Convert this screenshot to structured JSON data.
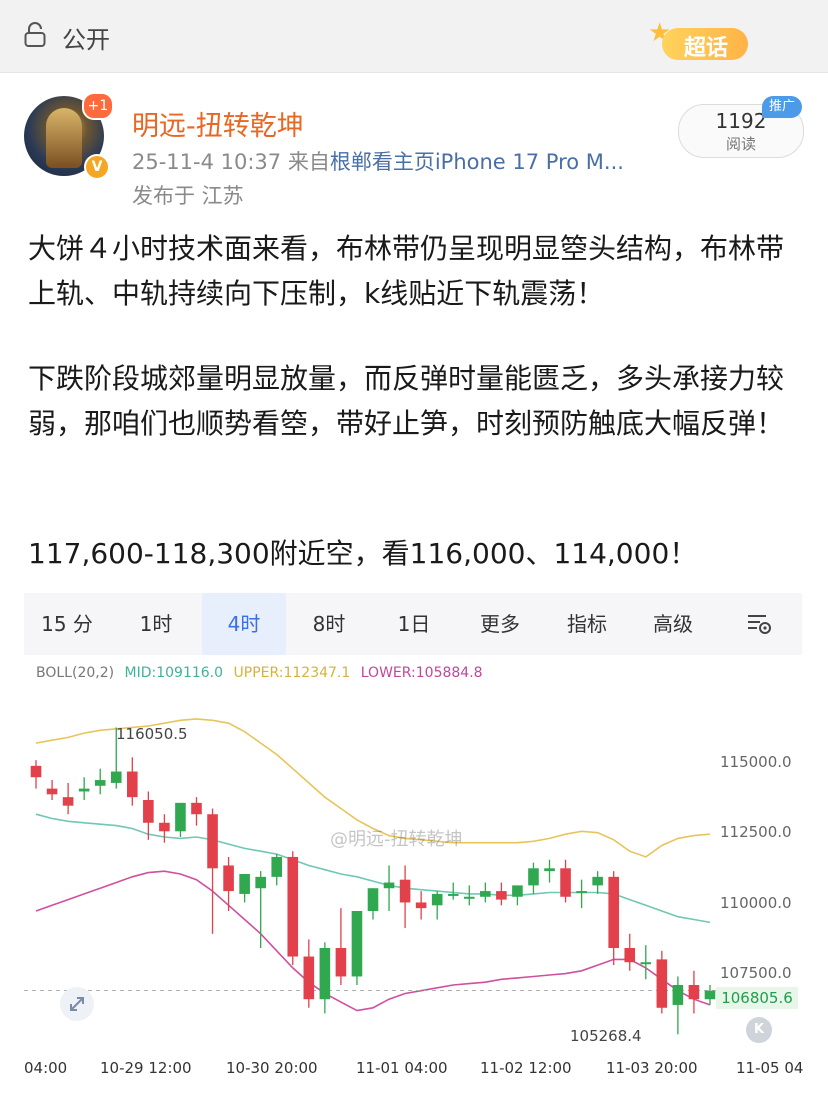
{
  "topbar": {
    "visibility": "公开",
    "supertopic": "超话"
  },
  "post": {
    "username": "明远-扭转乾坤",
    "avatar_badge": "+1",
    "time": "25-11-4 10:37",
    "source_prefix": "来自",
    "source": "根郸看主页iPhone 17 Pro M...",
    "location": "发布于 江苏",
    "read_count": "1192",
    "read_label": "阅读",
    "promo_tag": "推广",
    "paragraphs": [
      "大饼４小时技术面来看，布林带仍呈现明显箜头结构，布林带上轨、中轨持续向下压制，k线贴近下轨震荡！",
      "下跌阶段城郊量明显放量，而反弹时量能匮乏，多头承接力较弱，那咱们也顺势看箜，带好止笋，时刻预防触底大幅反弹！",
      "117,600-118,300附近空，看116,000、114,000！"
    ]
  },
  "chart_tabs": [
    "15 分",
    "1时",
    "4时",
    "8时",
    "1日",
    "更多",
    "指标",
    "高级"
  ],
  "active_tab": "4时",
  "boll": {
    "name": "BOLL(20,2)",
    "mid": "MID:109116.0",
    "upper": "UPPER:112347.1",
    "lower": "LOWER:105884.8"
  },
  "watermark": "@明远-扭转乾坤",
  "colors": {
    "up": "#2fa84f",
    "down": "#e2404a",
    "mid": "#6fc7b4",
    "upper": "#e7c55a",
    "lower": "#d04f9e",
    "accent": "#e86722"
  },
  "chart_data": {
    "type": "candlestick",
    "x_tick_labels": [
      "04:00",
      "10-29 12:00",
      "10-30 20:00",
      "11-01 04:00",
      "11-02 12:00",
      "11-03 20:00",
      "11-05 04"
    ],
    "y_tick_labels": [
      "115000.0",
      "112500.0",
      "110000.0",
      "107500.0"
    ],
    "current_price": "106805.6",
    "high_label": "116050.5",
    "low_label": "105268.4",
    "ylim": [
      104400,
      117400
    ],
    "candles": [
      [
        114700,
        114900,
        114300,
        113900
      ],
      [
        113900,
        114200,
        113700,
        113500
      ],
      [
        113600,
        114100,
        113300,
        113000
      ],
      [
        113800,
        114300,
        113900,
        113500
      ],
      [
        114000,
        114600,
        114200,
        113700
      ],
      [
        114100,
        116050,
        114500,
        113900
      ],
      [
        114500,
        115000,
        113600,
        113300
      ],
      [
        113500,
        113800,
        112700,
        112100
      ],
      [
        112700,
        113000,
        112400,
        112000
      ],
      [
        112400,
        113300,
        113400,
        112200
      ],
      [
        113400,
        113600,
        113000,
        112600
      ],
      [
        113000,
        113200,
        111100,
        108800
      ],
      [
        111200,
        111500,
        110300,
        109600
      ],
      [
        110200,
        110900,
        110900,
        109900
      ],
      [
        110400,
        111000,
        110800,
        108300
      ],
      [
        110800,
        111600,
        111500,
        110500
      ],
      [
        111500,
        111700,
        108000,
        107700
      ],
      [
        108000,
        108600,
        106500,
        106200
      ],
      [
        106500,
        108500,
        108300,
        106000
      ],
      [
        108300,
        109700,
        107300,
        107000
      ],
      [
        107300,
        109200,
        109600,
        107000
      ],
      [
        109600,
        110400,
        110400,
        109300
      ],
      [
        110400,
        111200,
        110600,
        109600
      ],
      [
        110700,
        111200,
        109900,
        109000
      ],
      [
        109900,
        110300,
        109700,
        109300
      ],
      [
        109800,
        110300,
        110200,
        109300
      ],
      [
        110200,
        110600,
        110200,
        110000
      ],
      [
        110100,
        110500,
        110100,
        109800
      ],
      [
        110100,
        110600,
        110300,
        109900
      ],
      [
        110300,
        110600,
        110000,
        109800
      ],
      [
        110100,
        110500,
        110500,
        109800
      ],
      [
        110500,
        111300,
        111100,
        110200
      ],
      [
        111000,
        111400,
        111100,
        110600
      ],
      [
        111100,
        111400,
        110100,
        109900
      ],
      [
        110300,
        110700,
        110300,
        109700
      ],
      [
        110500,
        111000,
        110800,
        110200
      ],
      [
        110800,
        111000,
        108300,
        107700
      ],
      [
        108300,
        108800,
        107800,
        107500
      ],
      [
        107800,
        108400,
        107800,
        107200
      ],
      [
        107900,
        108200,
        106200,
        106000
      ],
      [
        106300,
        107300,
        107000,
        105268
      ],
      [
        107000,
        107500,
        106500,
        106000
      ],
      [
        106500,
        107000,
        106800,
        106300
      ]
    ],
    "mid_line": [
      113000,
      112850,
      112750,
      112700,
      112650,
      112600,
      112500,
      112300,
      112200,
      112150,
      112200,
      112100,
      111950,
      111800,
      111700,
      111600,
      111400,
      111200,
      111050,
      110900,
      110800,
      110650,
      110500,
      110400,
      110350,
      110300,
      110250,
      110200,
      110200,
      110150,
      110150,
      110200,
      110250,
      110250,
      110250,
      110250,
      110200,
      110000,
      109800,
      109600,
      109400,
      109300,
      109200
    ],
    "upper_line": [
      115500,
      115600,
      115700,
      115850,
      115950,
      116000,
      116050,
      116100,
      116200,
      116300,
      116350,
      116300,
      116200,
      115900,
      115500,
      115100,
      114600,
      114100,
      113600,
      113200,
      112800,
      112500,
      112250,
      112150,
      112100,
      112050,
      112000,
      112000,
      112000,
      112000,
      112000,
      112050,
      112150,
      112300,
      112400,
      112350,
      112100,
      111700,
      111500,
      111900,
      112150,
      112250,
      112300
    ],
    "lower_line": [
      109600,
      109800,
      110000,
      110200,
      110400,
      110600,
      110800,
      110950,
      111000,
      110900,
      110700,
      110300,
      109800,
      109300,
      108800,
      108200,
      107600,
      107100,
      106700,
      106400,
      106100,
      106200,
      106500,
      106700,
      106800,
      106900,
      107000,
      107050,
      107100,
      107200,
      107250,
      107300,
      107350,
      107400,
      107500,
      107700,
      107900,
      107900,
      107600,
      107200,
      106800,
      106500,
      106300
    ]
  }
}
